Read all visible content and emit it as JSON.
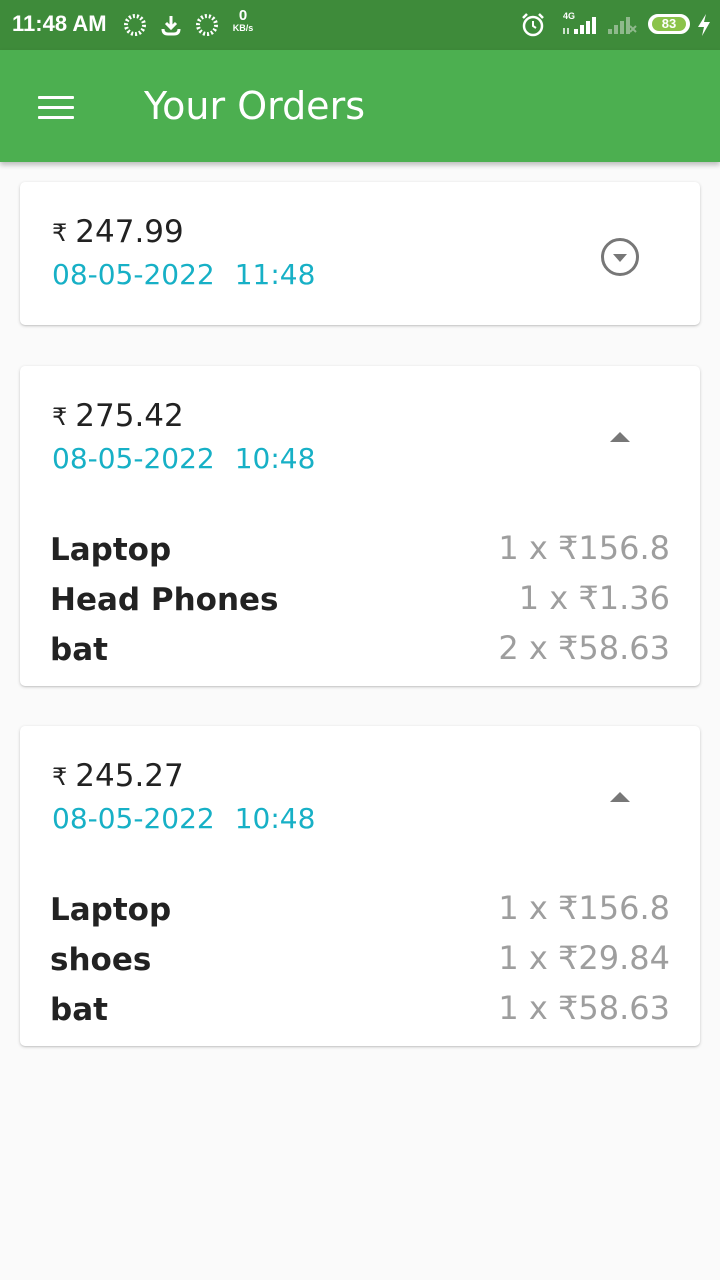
{
  "status_bar": {
    "time": "11:48 AM",
    "net_speed_value": "0",
    "net_speed_unit": "KB/s",
    "network_label": "4G",
    "battery": "83"
  },
  "app_bar": {
    "title": "Your Orders"
  },
  "currency_symbol": "₹",
  "orders": [
    {
      "total": "247.99",
      "date": "08-05-2022",
      "time": "11:48",
      "expanded": false,
      "items": []
    },
    {
      "total": "275.42",
      "date": "08-05-2022",
      "time": "10:48",
      "expanded": true,
      "items": [
        {
          "name": "Laptop",
          "qty": "1 x ₹156.8"
        },
        {
          "name": "Head Phones",
          "qty": "1 x ₹1.36"
        },
        {
          "name": "bat",
          "qty": "2 x ₹58.63"
        }
      ]
    },
    {
      "total": "245.27",
      "date": "08-05-2022",
      "time": "10:48",
      "expanded": true,
      "items": [
        {
          "name": "Laptop",
          "qty": "1 x ₹156.8"
        },
        {
          "name": "shoes",
          "qty": "1 x ₹29.84"
        },
        {
          "name": "bat",
          "qty": "1 x ₹58.63"
        }
      ]
    }
  ],
  "colors": {
    "status_bar": "#3e8b3a",
    "app_bar": "#4caf50",
    "date_text": "#17b0c6",
    "qty_text": "#9e9e9e"
  }
}
